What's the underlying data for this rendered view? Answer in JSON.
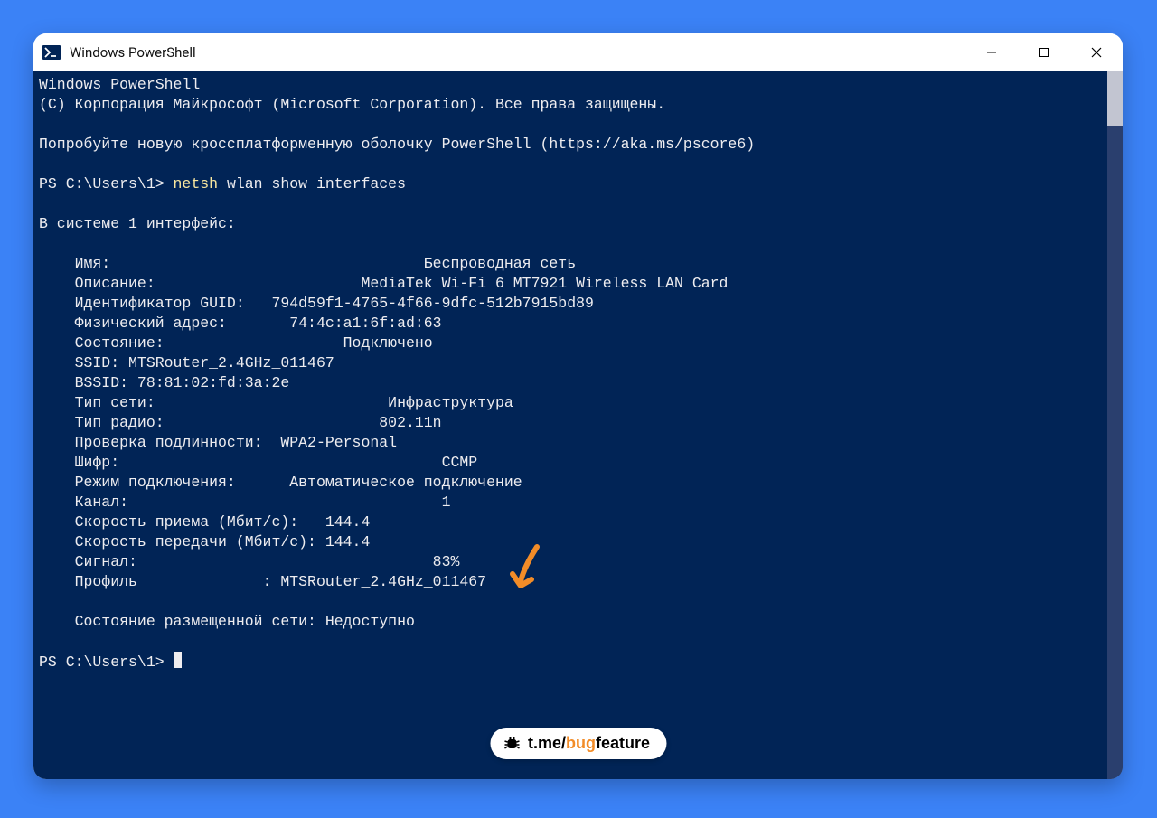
{
  "window": {
    "title": "Windows PowerShell"
  },
  "term": {
    "header1": "Windows PowerShell",
    "header2": "(С) Корпорация Майкрософт (Microsoft Corporation). Все права защищены.",
    "tryline": "Попробуйте новую кроссплатформенную оболочку PowerShell (https://aka.ms/pscore6)",
    "prompt1_prefix": "PS C:\\Users\\1> ",
    "prompt1_cmd": "netsh",
    "prompt1_args": " wlan show interfaces",
    "summary": "В системе 1 интерфейс:",
    "rows": [
      {
        "label": "Имя",
        "value": "Беспроводная сеть"
      },
      {
        "label": "Описание",
        "value": "MediaTek Wi-Fi 6 MT7921 Wireless LAN Card"
      },
      {
        "label": "Идентификатор GUID",
        "value": "794d59f1-4765-4f66-9dfc-512b7915bd89"
      },
      {
        "label": "Физический адрес",
        "value": "74:4c:a1:6f:ad:63"
      },
      {
        "label": "Состояние",
        "value": "Подключено"
      },
      {
        "label": "SSID",
        "value": "MTSRouter_2.4GHz_011467"
      },
      {
        "label": "BSSID",
        "value": "78:81:02:fd:3a:2e"
      },
      {
        "label": "Тип сети",
        "value": "Инфраструктура"
      },
      {
        "label": "Тип радио",
        "value": "802.11n"
      },
      {
        "label": "Проверка подлинности",
        "value": "WPA2-Personal"
      },
      {
        "label": "Шифр",
        "value": "CCMP"
      },
      {
        "label": "Режим подключения",
        "value": "Автоматическое подключение"
      },
      {
        "label": "Канал",
        "value": "1"
      },
      {
        "label": "Скорость приема (Мбит/с)",
        "value": "144.4"
      },
      {
        "label": "Скорость передачи (Мбит/с)",
        "value": "144.4"
      },
      {
        "label": "Сигнал",
        "value": "83%"
      },
      {
        "label": "Профиль",
        "value": "MTSRouter_2.4GHz_011467"
      }
    ],
    "hosted": "    Состояние размещенной сети: Недоступно",
    "prompt2": "PS C:\\Users\\1> "
  },
  "lines_raw": [
    "    Имя:                                   Беспроводная сеть",
    "    Описание:                       MediaTek Wi-Fi 6 MT7921 Wireless LAN Card",
    "    Идентификатор GUID:   794d59f1-4765-4f66-9dfc-512b7915bd89",
    "    Физический адрес:       74:4c:a1:6f:ad:63",
    "    Состояние:                    Подключено",
    "    SSID: MTSRouter_2.4GHz_011467",
    "    BSSID: 78:81:02:fd:3a:2e",
    "    Тип сети:                          Инфраструктура",
    "    Тип радио:                        802.11n",
    "    Проверка подлинности:  WPA2-Personal",
    "    Шифр:                                    CCMP",
    "    Режим подключения:      Автоматическое подключение",
    "    Канал:                                   1",
    "    Скорость приема (Мбит/с):   144.4",
    "    Скорость передачи (Мбит/с): 144.4",
    "    Сигнал:                                 83%",
    "    Профиль              : MTSRouter_2.4GHz_011467"
  ],
  "watermark": {
    "pre": "t.me/",
    "bug": "bug",
    "feat": "feature"
  },
  "colors": {
    "page_bg": "#3b82f6",
    "terminal_bg": "#012456",
    "terminal_fg": "#eeedf0",
    "cmd_highlight": "#f9e79f",
    "arrow": "#f28c28"
  }
}
